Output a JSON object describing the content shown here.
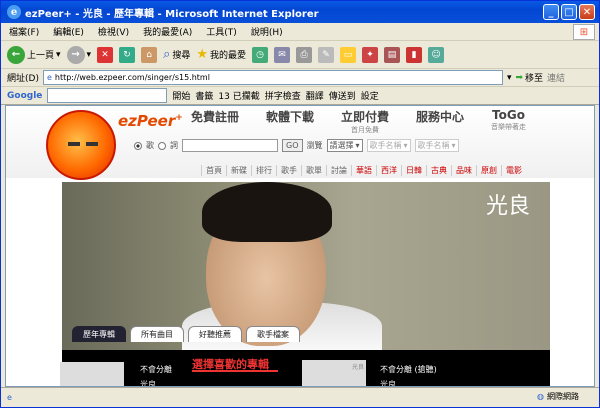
{
  "window": {
    "title": "ezPeer+ - 光良 - 歷年專輯 - Microsoft Internet Explorer"
  },
  "menu": [
    "檔案(F)",
    "編輯(E)",
    "檢視(V)",
    "我的最愛(A)",
    "工具(T)",
    "說明(H)"
  ],
  "toolbar": {
    "back": "上一頁",
    "search": "搜尋",
    "favorites": "我的最愛"
  },
  "address": {
    "label": "網址(D)",
    "url": "http://web.ezpeer.com/singer/s15.html",
    "go": "移至",
    "links": "連結"
  },
  "google": {
    "logo": "Google",
    "search_start": "開始",
    "bookmarks": "書籤",
    "blocked": "13 已攔截",
    "spell": "拼字檢查",
    "translate": "翻譯",
    "send": "傳送到",
    "settings": "設定"
  },
  "site": {
    "brand": "ezPeer",
    "nav": [
      {
        "label": "免費註冊",
        "sub": ""
      },
      {
        "label": "軟體下載",
        "sub": ""
      },
      {
        "label": "立即付費",
        "sub": "首月免費"
      },
      {
        "label": "服務中心",
        "sub": ""
      },
      {
        "label": "ToGo",
        "sub": "音樂帶著走"
      }
    ],
    "search": {
      "radio1": "歌",
      "radio2": "詞",
      "go": "GO",
      "browse": "瀏覽",
      "select": "請選擇",
      "genre": "歌手名稱",
      "genre2": "歌手名稱"
    },
    "categories": [
      "首頁",
      "新碟",
      "排行",
      "歌手",
      "歌單",
      "討論",
      "華語",
      "西洋",
      "日韓",
      "古典",
      "品味",
      "原創",
      "電影"
    ]
  },
  "hero": {
    "singer": "光良",
    "tabs": [
      "歷年專輯",
      "所有曲目",
      "好聽推薦",
      "歌手檔案"
    ],
    "choose": "選擇喜歡的專輯",
    "album1_title": "不會分離",
    "album1_artist": "光良",
    "album2_title": "不會分離 (搶聽)",
    "album2_artist": "光良",
    "art_label": "光良"
  },
  "status": {
    "zone": "網際網路"
  }
}
